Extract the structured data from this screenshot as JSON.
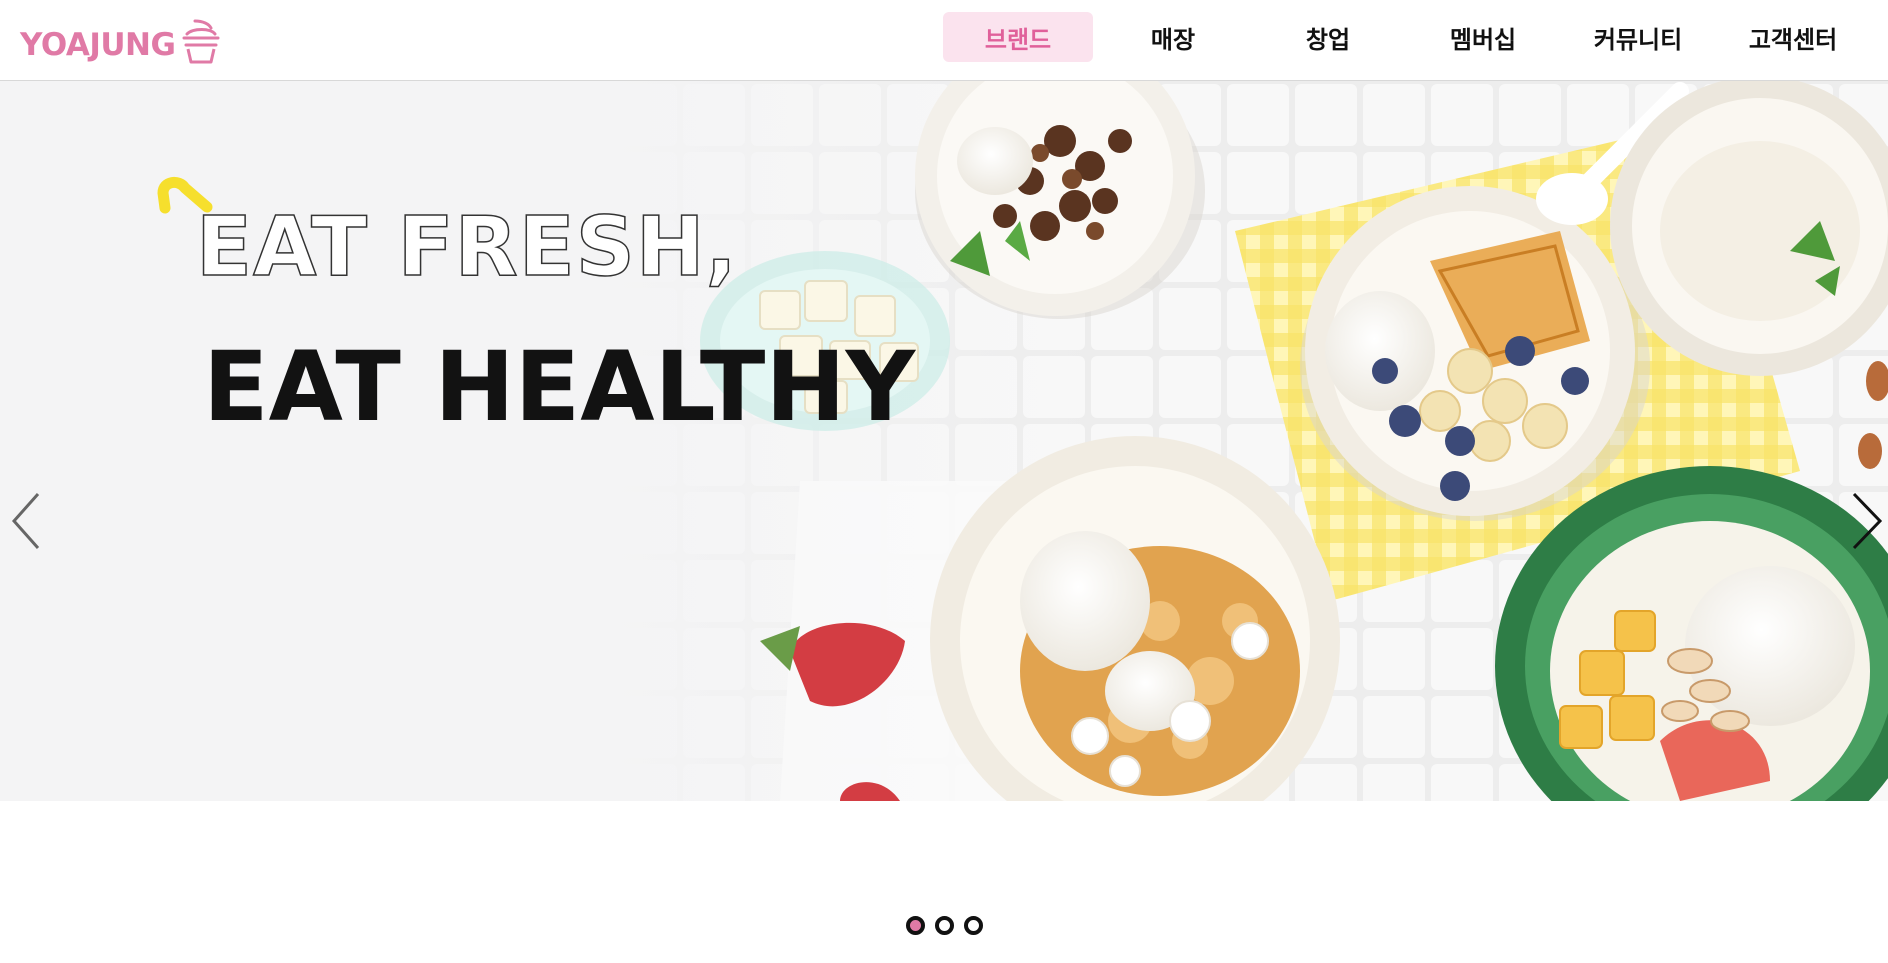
{
  "brand": {
    "logo_text": "YOAJUNG",
    "accent_color": "#e07aa6"
  },
  "nav": {
    "items": [
      {
        "label": "브랜드",
        "active": true
      },
      {
        "label": "매장",
        "active": false
      },
      {
        "label": "창업",
        "active": false
      },
      {
        "label": "멤버십",
        "active": false
      },
      {
        "label": "커뮤니티",
        "active": false
      },
      {
        "label": "고객센터",
        "active": false
      }
    ]
  },
  "hero": {
    "headline_1": "EAT FRESH,",
    "headline_2": "EAT HEALTHY",
    "prev_icon": "chevron-left-icon",
    "next_icon": "chevron-right-icon"
  },
  "pagination": {
    "count": 3,
    "active_index": 0
  }
}
